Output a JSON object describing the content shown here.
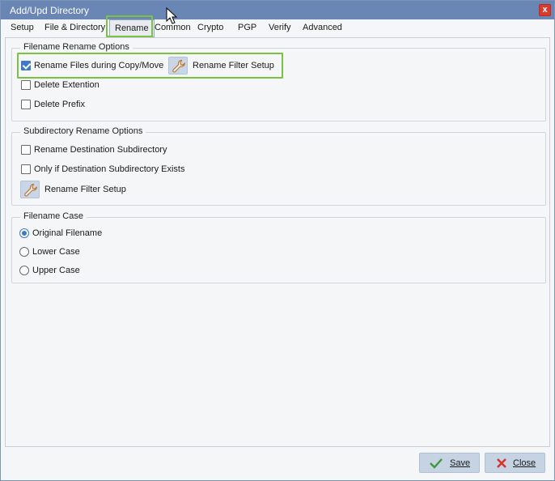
{
  "window": {
    "title": "Add/Upd Directory",
    "close_glyph": "x"
  },
  "tabs": [
    {
      "label": "Setup"
    },
    {
      "label": "File & Directory"
    },
    {
      "label": "Rename",
      "active": true
    },
    {
      "label": "Common"
    },
    {
      "label": "Crypto"
    },
    {
      "label": "PGP"
    },
    {
      "label": "Verify"
    },
    {
      "label": "Advanced"
    }
  ],
  "filename_rename": {
    "title": "Filename Rename Options",
    "rename_files": {
      "label": "Rename Files during Copy/Move",
      "checked": true
    },
    "filter_setup_label": "Rename Filter Setup",
    "delete_extention": {
      "label": "Delete Extention",
      "checked": false
    },
    "delete_prefix": {
      "label": "Delete Prefix",
      "checked": false
    }
  },
  "subdir_rename": {
    "title": "Subdirectory Rename Options",
    "rename_dest": {
      "label": "Rename Destination Subdirectory",
      "checked": false
    },
    "only_if_exists": {
      "label": "Only if Destination Subdirectory Exists",
      "checked": false
    },
    "filter_setup_label": "Rename Filter Setup"
  },
  "filename_case": {
    "title": "Filename Case",
    "selected": "Original Filename",
    "options": [
      "Original Filename",
      "Lower Case",
      "Upper Case"
    ]
  },
  "footer": {
    "save_label": "Save",
    "close_label": "Close"
  },
  "colors": {
    "highlight": "#7cc242",
    "titlebar": "#6a86b4",
    "accent": "#3f78c8"
  },
  "icons": [
    "wrench-icon",
    "checkmark-icon",
    "close-x-icon",
    "mouse-cursor-icon"
  ]
}
